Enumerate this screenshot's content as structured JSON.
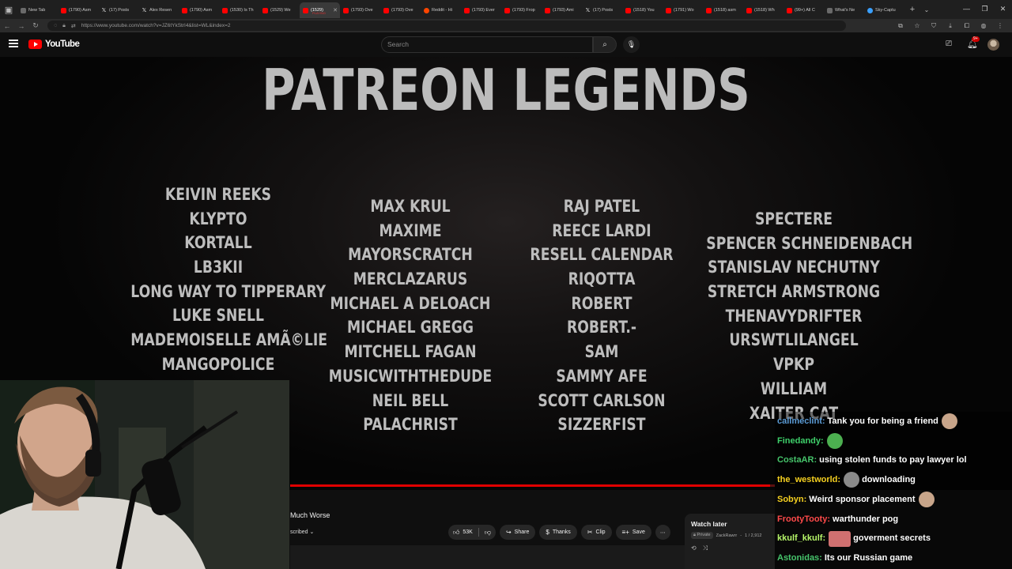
{
  "browser": {
    "tabs": [
      {
        "title": "New Tab",
        "favicon": "blank"
      },
      {
        "title": "(1790) Asm",
        "favicon": "yt"
      },
      {
        "title": "(17) Posts",
        "favicon": "x"
      },
      {
        "title": "Alex Resen",
        "favicon": "x"
      },
      {
        "title": "(1790) Asm",
        "favicon": "yt"
      },
      {
        "title": "(1530) Is Th",
        "favicon": "yt"
      },
      {
        "title": "(1529) We",
        "favicon": "yt"
      },
      {
        "title": "(1529)",
        "favicon": "yt",
        "active": true,
        "subtitle": "PLAYING"
      },
      {
        "title": "(1793) Ove",
        "favicon": "yt"
      },
      {
        "title": "(1793) Ove",
        "favicon": "yt"
      },
      {
        "title": "Reddit - Hi",
        "favicon": "reddit"
      },
      {
        "title": "(1793) Ever",
        "favicon": "yt"
      },
      {
        "title": "(1793) Frop",
        "favicon": "yt"
      },
      {
        "title": "(1793) Ami",
        "favicon": "yt"
      },
      {
        "title": "(17) Posts",
        "favicon": "x"
      },
      {
        "title": "(1518) You",
        "favicon": "yt"
      },
      {
        "title": "(1791) Wo",
        "favicon": "yt"
      },
      {
        "title": "(1518) asm",
        "favicon": "yt"
      },
      {
        "title": "(1518) Wh",
        "favicon": "yt"
      },
      {
        "title": "(99+) All C",
        "favicon": "yt"
      },
      {
        "title": "What's Ne",
        "favicon": "blank"
      },
      {
        "title": "Sky-Captu",
        "favicon": "sky"
      }
    ],
    "url": "https://www.youtube.com/watch?v=JZ6tYkStrI4&list=WL&index=2"
  },
  "youtube": {
    "brand": "YouTube",
    "search_placeholder": "Search",
    "notification_count": "9+"
  },
  "video": {
    "title": "PATREON LEGENDS",
    "columns": [
      [
        "KEIVIN REEKS",
        "KLYPTO",
        "KORTALL",
        "LB3KII",
        "LONG WAY TO TIPPERARY",
        "LUKE SNELL",
        "MADEMOISELLE AMÃ©LIE",
        "MANGOPOLICE"
      ],
      [
        "MAX KRUL",
        "MAXIME",
        "MAYORSCRATCH",
        "MERCLAZARUS",
        "MICHAEL A DELOACH",
        "MICHAEL GREGG",
        "MITCHELL FAGAN",
        "MUSICWITHTHEDUDE",
        "NEIL BELL",
        "PALACHRIST"
      ],
      [
        "RAJ PATEL",
        "REECE LARDI",
        "RESELL CALENDAR",
        "RIQOTTA",
        "ROBERT",
        "ROBERT.-",
        "SAM",
        "SAMMY AFE",
        "SCOTT CARLSON",
        "SIZZERFIST"
      ],
      [
        "SPECTERE",
        "SPENCER SCHNEIDENBACH",
        "STANISLAV NECHUTNY",
        "STRETCH ARMSTRONG",
        "THENAVYDRIFTER",
        "URSWTLILANGEL",
        "VPKP",
        "WILLIAM",
        "XAITER CAT"
      ]
    ],
    "progress": 0.99
  },
  "below_player": {
    "title_fragment": "Much Worse",
    "subscribe_fragment": "scribed",
    "like_count": "53K",
    "share_label": "Share",
    "thanks_label": "Thanks",
    "clip_label": "Clip",
    "save_label": "Save"
  },
  "watch_later": {
    "title": "Watch later",
    "privacy": "Private",
    "owner": "ZackRawrr",
    "position": "1 / 2,912"
  },
  "chat": [
    {
      "user": "callmeclint:",
      "color": "#5b9bd5",
      "text": "Tank you for being a friend",
      "emote": "round",
      "emote_color": "#c8a58a"
    },
    {
      "user": "Finedandy:",
      "color": "#3ecf6a",
      "text": "",
      "emote": "round",
      "emote_color": "#4caf50"
    },
    {
      "user": "CostaAR:",
      "color": "#46c46b",
      "text": "using stolen funds to pay lawyer lol",
      "emote": "",
      "emote_color": ""
    },
    {
      "user": "the_westworld:",
      "color": "#f5d020",
      "text": "downloading",
      "emote": "round",
      "emote_color": "#8a8a8a"
    },
    {
      "user": "Sobyn:",
      "color": "#f5d020",
      "text": "Weird sponsor placement",
      "emote": "round",
      "emote_color": "#c8a58a"
    },
    {
      "user": "FrootyTooty:",
      "color": "#ff4a4a",
      "text": "warthunder pog",
      "emote": "",
      "emote_color": ""
    },
    {
      "user": "kkulf_kkulf:",
      "color": "#b6f569",
      "text": "goverment secrets",
      "emote": "rect",
      "emote_color": "#d07070"
    },
    {
      "user": "Astonidas:",
      "color": "#46c46b",
      "text": "Its our Russian game",
      "emote": "",
      "emote_color": ""
    }
  ]
}
